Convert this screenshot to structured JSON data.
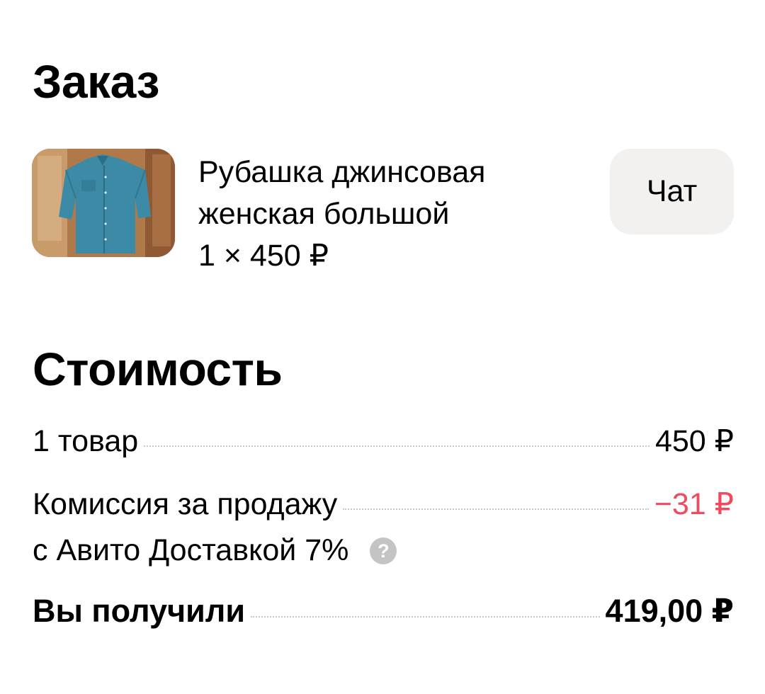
{
  "order": {
    "title": "Заказ",
    "product": {
      "name_line1": "Рубашка джинсовая",
      "name_line2": "женская большой",
      "quantity_price": "1 × 450 ₽",
      "image": "denim-shirt-photo"
    },
    "chat_label": "Чат"
  },
  "cost": {
    "title": "Стоимость",
    "items_label": "1 товар",
    "items_amount": "450 ₽",
    "commission_line1": "Комиссия за продажу",
    "commission_line2": "с Авито Доставкой 7%",
    "commission_amount": "−31 ₽",
    "total_label": "Вы получили",
    "total_amount": "419,00 ₽"
  },
  "colors": {
    "negative_amount": "#f04a5f",
    "chat_button_bg": "#f2f1f0",
    "help_icon": "#c4c4c4"
  },
  "icons": {
    "help": "question-circle-icon"
  }
}
